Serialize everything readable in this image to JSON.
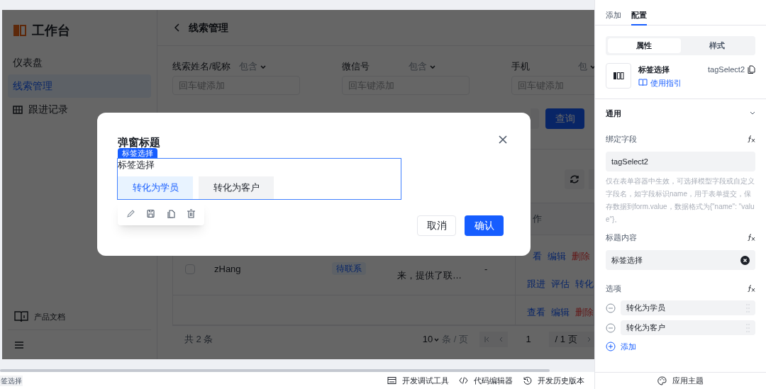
{
  "sidebar": {
    "title": "工作台",
    "items": [
      {
        "label": "仪表盘",
        "selected": false,
        "kind": "plain"
      },
      {
        "label": "线索管理",
        "selected": true,
        "kind": "plain"
      },
      {
        "label": "跟进记录",
        "selected": false,
        "kind": "grid"
      }
    ],
    "docs": "产品文档"
  },
  "page": {
    "title": "线索管理",
    "filters": [
      {
        "label": "线索姓名/昵称",
        "operator": "包含",
        "placeholder": "回车键添加"
      },
      {
        "label": "微信号",
        "operator": "包含",
        "placeholder": "回车键添加"
      },
      {
        "label": "手机",
        "operator": "包",
        "placeholder": "回车键添加"
      }
    ],
    "query_button": "查询"
  },
  "table": {
    "action_header": "作",
    "rows": [
      {
        "checked": false,
        "name": "zHang",
        "status": "待联系",
        "remark": "来，提供了联…",
        "column_5": "-",
        "actions": [
          [
            {
              "label": "看",
              "kind": "link"
            },
            {
              "label": "编辑",
              "kind": "link"
            },
            {
              "label": "删除",
              "kind": "danger"
            }
          ],
          [
            {
              "label": "跟进",
              "kind": "link"
            },
            {
              "label": "评估",
              "kind": "link"
            },
            {
              "label": "转化",
              "kind": "link"
            }
          ]
        ]
      },
      {
        "actions": [
          [
            {
              "label": "查看",
              "kind": "link"
            },
            {
              "label": "编辑",
              "kind": "link"
            },
            {
              "label": "删除",
              "kind": "danger"
            }
          ]
        ]
      }
    ]
  },
  "pagination": {
    "total": "共 2 条",
    "page_size": "10",
    "per_page": "条 / 页",
    "page": "1",
    "pages": "/ 1 页"
  },
  "modal": {
    "title": "弹窗标题",
    "selection_label": "标签选择",
    "field_label": "标签选择",
    "tags": [
      {
        "label": "转化为学员",
        "selected": true
      },
      {
        "label": "转化为客户",
        "selected": false
      }
    ],
    "buttons": [
      {
        "label": "取消",
        "kind": "default"
      },
      {
        "label": "确认",
        "kind": "primary"
      }
    ]
  },
  "panel": {
    "tabs": [
      {
        "label": "添加",
        "selected": false
      },
      {
        "label": "配置",
        "selected": true
      }
    ],
    "segments": [
      {
        "label": "属性",
        "selected": true
      },
      {
        "label": "样式",
        "selected": false
      }
    ],
    "component": {
      "name": "标签选择",
      "guide": "使用指引",
      "id": "tagSelect2"
    },
    "section": {
      "title": "通用",
      "expanded": true
    },
    "bind_field": {
      "label": "绑定字段",
      "value": "tagSelect2",
      "help": "仅在表单容器中生效，可选择模型字段或自定义字段名，如字段标识name，用于表单提交，保存数据到form.value，数据格式为{\"name\": \"value\"}。"
    },
    "title_field": {
      "label": "标题内容",
      "value": "标签选择"
    },
    "options": {
      "label": "选项",
      "items": [
        "转化为学员",
        "转化为客户"
      ],
      "add": "添加"
    }
  },
  "status_bar": {
    "left": "签选择",
    "items": [
      {
        "label": "开发调试工具",
        "kind": "devtools"
      },
      {
        "label": "代码编辑器",
        "kind": "code"
      },
      {
        "label": "开发历史版本",
        "kind": "history"
      },
      {
        "label": "应用主题",
        "kind": "theme"
      }
    ]
  }
}
